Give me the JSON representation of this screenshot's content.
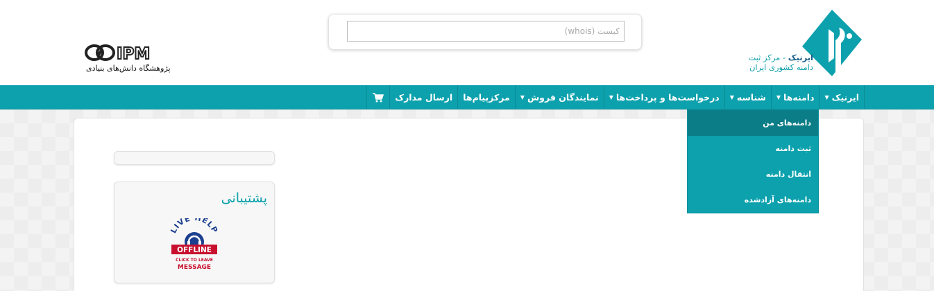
{
  "header": {
    "irnic": {
      "brand": "ایرنیک",
      "line1_rest": " - مرکز ثبت",
      "line2": "دامنه کشوری ایران"
    },
    "search": {
      "placeholder": "کیست (whois)"
    },
    "ipm": {
      "wordmark": "IPM",
      "caption": "پژوهشگاه دانش‌های بنیادی"
    }
  },
  "nav": {
    "items": [
      {
        "label": "ایرنیک",
        "has_caret": true
      },
      {
        "label": "دامنه‌ها",
        "has_caret": true
      },
      {
        "label": "شناسه",
        "has_caret": true
      },
      {
        "label": "درخواست‌ها و پرداخت‌ها",
        "has_caret": true
      },
      {
        "label": "نمایندگان فروش",
        "has_caret": true
      },
      {
        "label": "مرکزپیام‌ها",
        "has_caret": false
      },
      {
        "label": "ارسال مدارک",
        "has_caret": false
      }
    ],
    "cart_icon": "cart-icon"
  },
  "dropdown": {
    "items": [
      {
        "label": "دامنه‌های من",
        "active": true
      },
      {
        "label": "ثبت دامنه",
        "active": false
      },
      {
        "label": "انتقال دامنه",
        "active": false
      },
      {
        "label": "دامنه‌های آزادشده",
        "active": false
      }
    ]
  },
  "support": {
    "title": "پشتیبانی",
    "badge": {
      "top": "LIVE HELP",
      "status": "OFFLINE",
      "line1": "CLICK TO LEAVE",
      "line2": "MESSAGE"
    }
  },
  "colors": {
    "accent": "#0ca1ad",
    "accent_dark": "#0a7d86",
    "brand_blue": "#1a5f8c",
    "badge_red": "#c8102e"
  }
}
